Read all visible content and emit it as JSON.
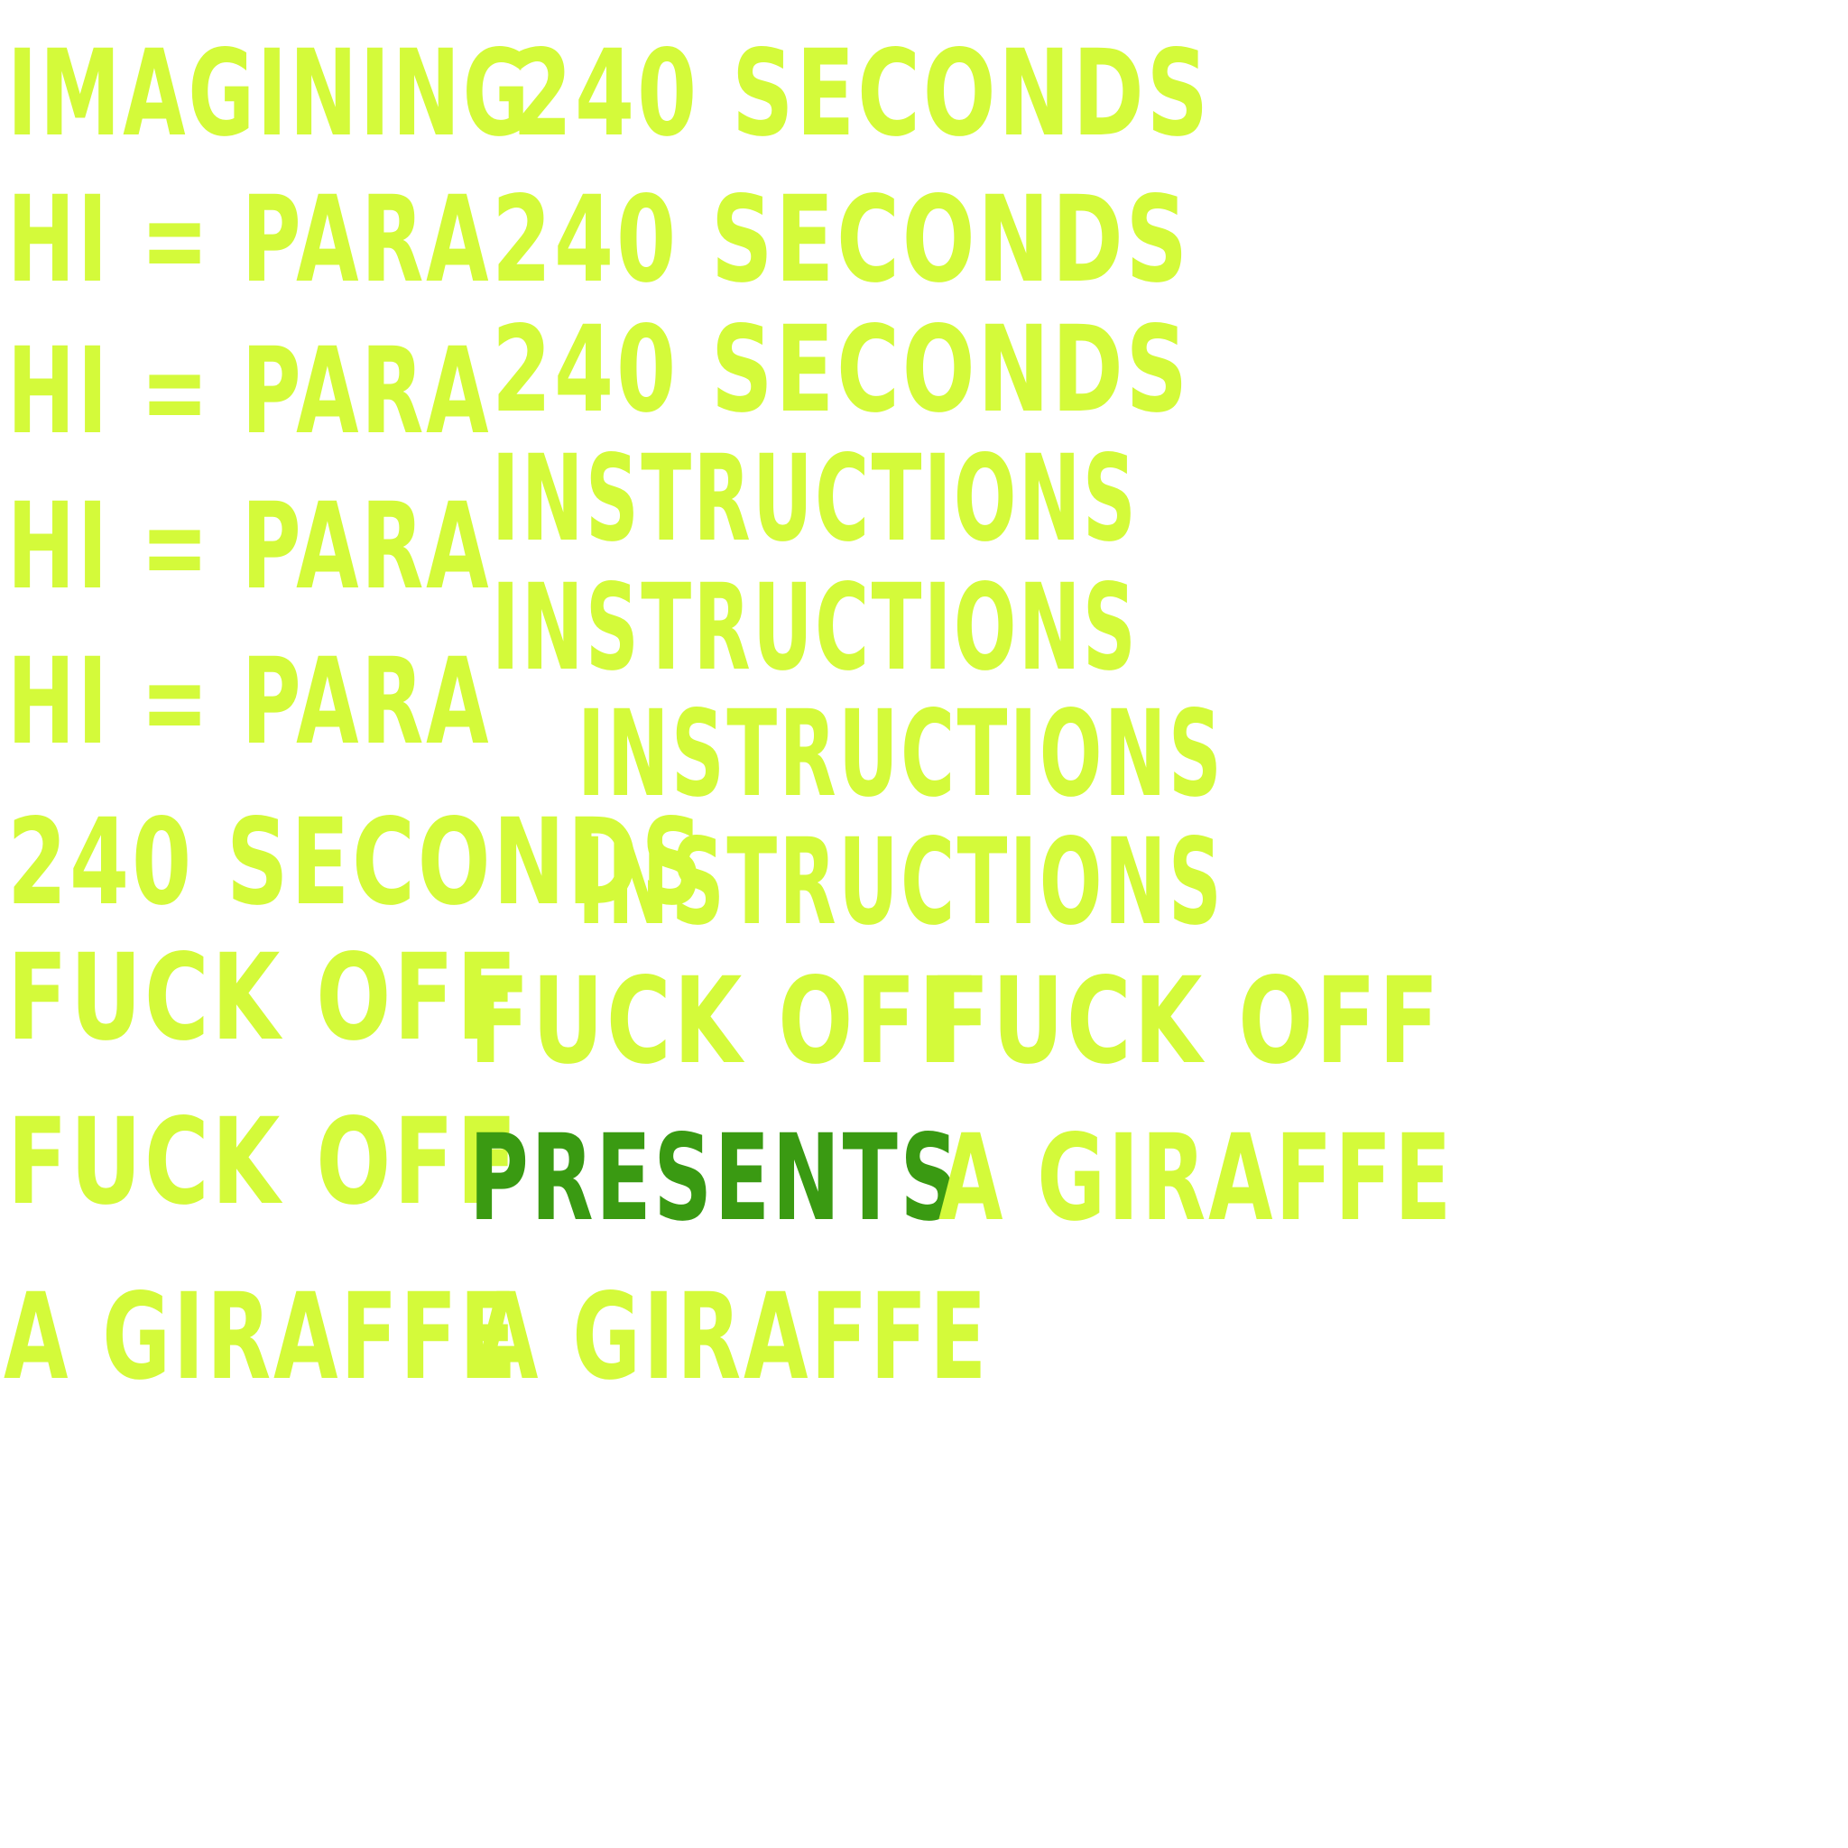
{
  "colors": {
    "lime": "#d4fa3a",
    "dark_green": "#3a9a12",
    "background": "#ffffff"
  },
  "words": {
    "imagining": "IMAGINING",
    "seconds": "240 SECONDS",
    "hi_para": "HI = PARA",
    "instructions": "INSTRUCTIONS",
    "fuck_off": "FUCK OFF",
    "presents": "PRESENTS",
    "a_giraffe": "A GIRAFFE"
  }
}
